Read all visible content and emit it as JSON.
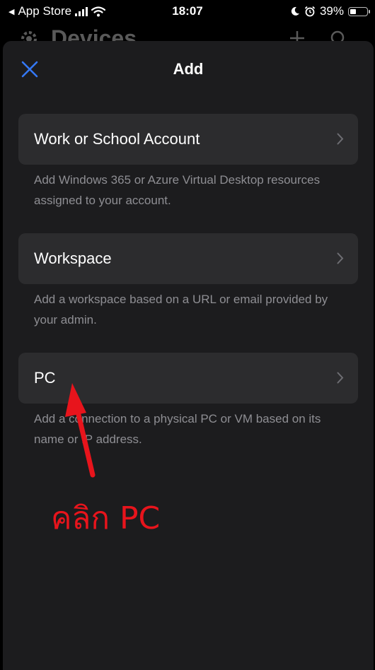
{
  "status_bar": {
    "back_app": "App Store",
    "time": "18:07",
    "battery": "39%",
    "battery_level": 0.39
  },
  "background_header": {
    "title": "Devices"
  },
  "sheet": {
    "title": "Add",
    "options": [
      {
        "label": "Work or School Account",
        "description": "Add Windows 365 or Azure Virtual Desktop resources assigned to your account."
      },
      {
        "label": "Workspace",
        "description": "Add a workspace based on a URL or email provided by your admin."
      },
      {
        "label": "PC",
        "description": "Add a connection to a physical PC or VM based on its name or IP address."
      }
    ]
  },
  "annotation": {
    "text": "คลิก PC",
    "color": "#e8141c"
  },
  "colors": {
    "accent": "#3478f6",
    "sheet_bg": "#1c1c1e",
    "row_bg": "#2c2c2e",
    "secondary_text": "#8e8e93"
  }
}
